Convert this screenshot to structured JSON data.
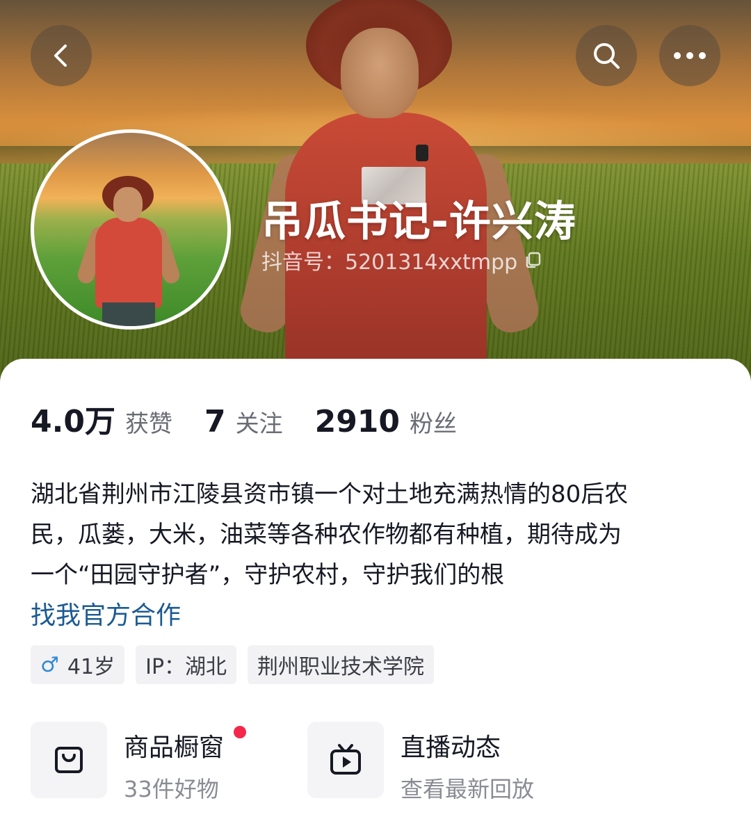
{
  "header": {
    "back_icon": "chevron-left-icon",
    "search_icon": "search-icon",
    "more_icon": "more-dots-icon"
  },
  "profile": {
    "nickname": "吊瓜书记-许兴涛",
    "douyin_id": "抖音号：5201314xxtmpp",
    "copy_icon": "copy-icon"
  },
  "stats": {
    "likes": {
      "value": "4.0万",
      "label": "获赞"
    },
    "following": {
      "value": "7",
      "label": "关注"
    },
    "followers": {
      "value": "2910",
      "label": "粉丝"
    }
  },
  "bio": {
    "line1": "湖北省荆州市江陵县资市镇一个对土地充满热情的80后农",
    "line2": "民，瓜蒌，大米，油菜等各种农作物都有种植，期待成为",
    "line3": "一个“田园守护者”，守护农村，守护我们的根",
    "collab_link": "找我官方合作"
  },
  "tags": {
    "age": "41岁",
    "ip": "IP：湖北",
    "school": "荆州职业技术学院"
  },
  "features": {
    "shop": {
      "title": "商品橱窗",
      "subtitle": "33件好物",
      "icon": "shopping-bag-icon"
    },
    "live": {
      "title": "直播动态",
      "subtitle": "查看最新回放",
      "icon": "tv-play-icon"
    }
  },
  "colors": {
    "link": "#1b5a93",
    "notification_dot": "#f4274b",
    "male_icon": "#2f88d6"
  }
}
